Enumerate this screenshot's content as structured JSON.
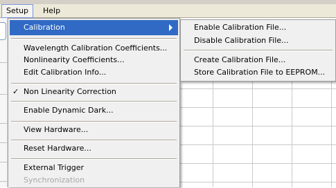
{
  "menubar": {
    "items": [
      {
        "label": "Setup"
      },
      {
        "label": "Help"
      }
    ]
  },
  "setup_menu": {
    "items": [
      {
        "label": "Calibration",
        "selected": true,
        "has_submenu": true
      },
      {
        "label": "Wavelength Calibration Coefficients..."
      },
      {
        "label": "Nonlinearity Coefficients..."
      },
      {
        "label": "Edit Calibration Info..."
      },
      {
        "label": "Non Linearity Correction",
        "checked": true,
        "check_mark": "✓"
      },
      {
        "label": "Enable Dynamic Dark..."
      },
      {
        "label": "View Hardware..."
      },
      {
        "label": "Reset Hardware..."
      },
      {
        "label": "External Trigger"
      },
      {
        "label": "Synchronization",
        "disabled": true
      }
    ]
  },
  "calibration_submenu": {
    "items": [
      {
        "label": "Enable Calibration File..."
      },
      {
        "label": "Disable Calibration File..."
      },
      {
        "label": "Create Calibration File..."
      },
      {
        "label": "Store Calibration File to EEPROM..."
      }
    ]
  },
  "colors": {
    "highlight": "#316ac5",
    "menu_bg": "#f0f0f0",
    "menubar_bg": "#ece9d8",
    "disabled_text": "#a7a6aa"
  }
}
